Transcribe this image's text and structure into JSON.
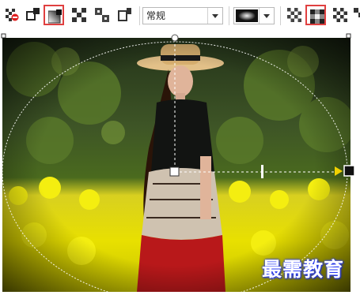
{
  "toolbar": {
    "tool_icons_left": [
      "transparency-clear-icon",
      "transparency-linear-icon",
      "transparency-elliptical-icon",
      "transparency-conical-icon",
      "transparency-rectangular-icon",
      "transparency-square-icon"
    ],
    "merge_mode": "常规",
    "tool_icons_right": [
      "pattern-1-icon",
      "pattern-2-icon",
      "pattern-3-icon"
    ]
  },
  "canvas": {
    "watermark": "最需教育"
  },
  "colors": {
    "highlight": "#e04040",
    "watermark_glow": "#2a3cff",
    "handle_arrow": "#f0d000"
  }
}
